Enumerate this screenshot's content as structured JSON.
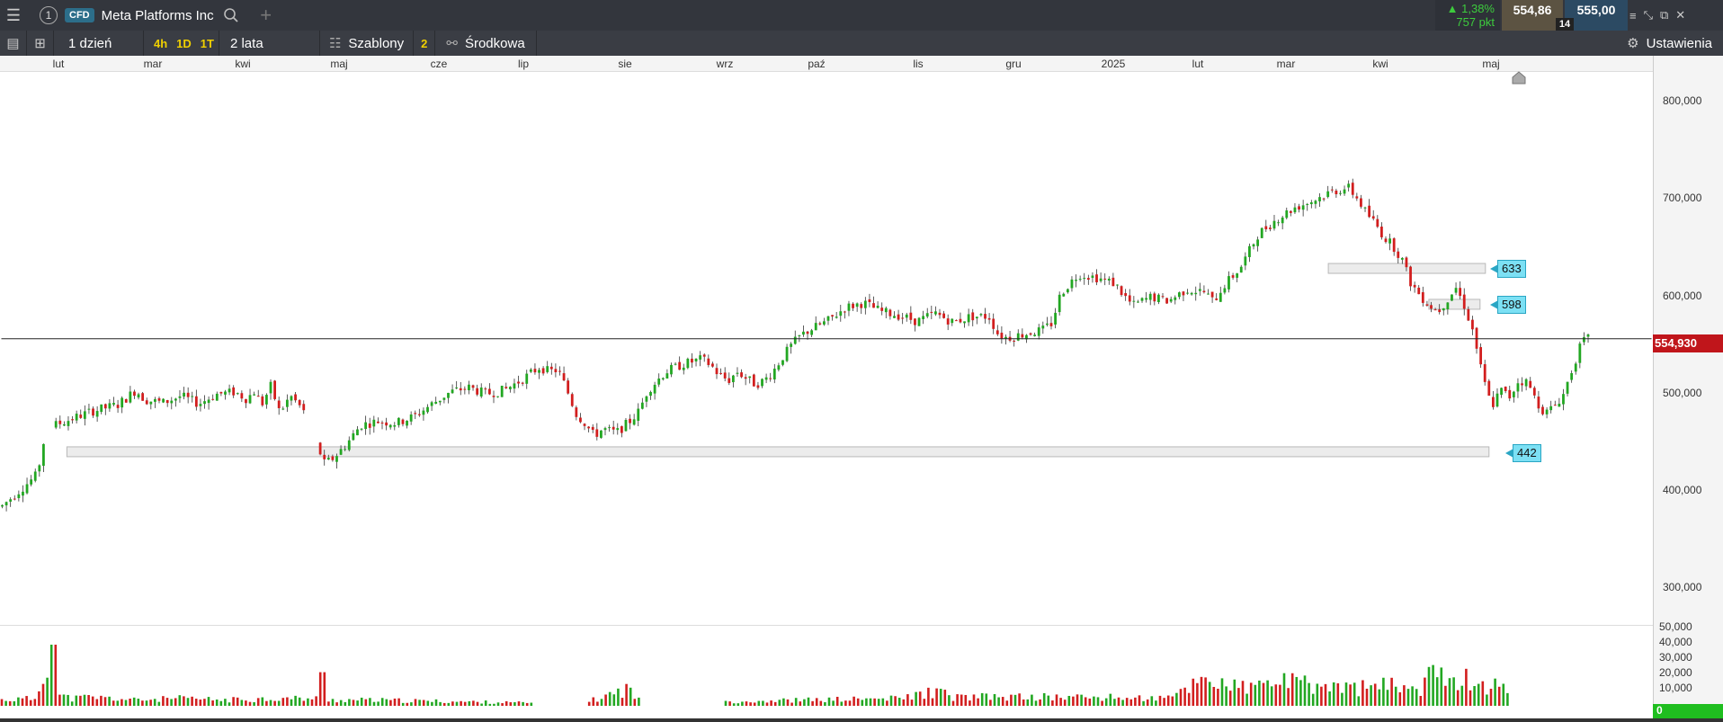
{
  "topbar": {
    "window_number": "1",
    "badge": "CFD",
    "instrument": "Meta Platforms Inc",
    "change_pct": "▲ 1,38%",
    "change_pts": "757 pkt",
    "sell_price": "554,86",
    "spread": "14",
    "buy_price": "555,00"
  },
  "toolbar": {
    "interval": "1 dzień",
    "quick_4h": "4h",
    "quick_1d": "1D",
    "quick_1t": "1T",
    "range": "2 lata",
    "templates": "Szablony",
    "indicator_count": "2",
    "indicator": "Środkowa",
    "settings": "Ustawienia"
  },
  "chart_data": {
    "type": "candlestick",
    "x_labels": [
      "lut",
      "mar",
      "kwi",
      "maj",
      "cze",
      "lip",
      "sie",
      "wrz",
      "paź",
      "lis",
      "gru",
      "2025",
      "lut",
      "mar",
      "kwi",
      "maj"
    ],
    "y_ticks": [
      "800,000",
      "700,000",
      "600,000",
      "500,000",
      "400,000",
      "300,000"
    ],
    "volume_ticks": [
      "50,000",
      "40,000",
      "30,000",
      "20,000",
      "10,000",
      "0"
    ],
    "current_price": "554,930",
    "ylim": [
      260,
      830
    ],
    "levels": [
      {
        "label": "633",
        "value": 627
      },
      {
        "label": "598",
        "value": 590
      },
      {
        "label": "442",
        "value": 438
      }
    ],
    "price_path": [
      [
        0,
        382
      ],
      [
        40,
        415
      ],
      [
        50,
        462
      ],
      [
        60,
        466
      ],
      [
        80,
        473
      ],
      [
        100,
        480
      ],
      [
        130,
        487
      ],
      [
        150,
        502
      ],
      [
        160,
        492
      ],
      [
        180,
        489
      ],
      [
        200,
        496
      ],
      [
        220,
        488
      ],
      [
        240,
        498
      ],
      [
        260,
        500
      ],
      [
        275,
        492
      ],
      [
        280,
        503
      ],
      [
        290,
        487
      ],
      [
        300,
        506
      ],
      [
        310,
        479
      ],
      [
        322,
        496
      ],
      [
        335,
        483
      ],
      [
        360,
        426
      ],
      [
        370,
        432
      ],
      [
        385,
        447
      ],
      [
        400,
        466
      ],
      [
        420,
        470
      ],
      [
        440,
        468
      ],
      [
        460,
        475
      ],
      [
        480,
        488
      ],
      [
        500,
        500
      ],
      [
        520,
        505
      ],
      [
        540,
        498
      ],
      [
        560,
        502
      ],
      [
        580,
        513
      ],
      [
        600,
        526
      ],
      [
        610,
        521
      ],
      [
        620,
        523
      ],
      [
        630,
        502
      ],
      [
        640,
        478
      ],
      [
        650,
        468
      ],
      [
        660,
        455
      ],
      [
        670,
        462
      ],
      [
        685,
        458
      ],
      [
        700,
        470
      ],
      [
        710,
        480
      ],
      [
        720,
        502
      ],
      [
        740,
        521
      ],
      [
        760,
        529
      ],
      [
        780,
        534
      ],
      [
        790,
        528
      ],
      [
        800,
        517
      ],
      [
        810,
        512
      ],
      [
        820,
        521
      ],
      [
        830,
        514
      ],
      [
        840,
        508
      ],
      [
        850,
        512
      ],
      [
        860,
        522
      ],
      [
        870,
        536
      ],
      [
        880,
        548
      ],
      [
        890,
        558
      ],
      [
        900,
        564
      ],
      [
        920,
        573
      ],
      [
        940,
        587
      ],
      [
        960,
        592
      ],
      [
        980,
        583
      ],
      [
        1000,
        579
      ],
      [
        1020,
        573
      ],
      [
        1040,
        581
      ],
      [
        1060,
        572
      ],
      [
        1080,
        578
      ],
      [
        1100,
        578
      ],
      [
        1110,
        560
      ],
      [
        1120,
        556
      ],
      [
        1140,
        560
      ],
      [
        1160,
        564
      ],
      [
        1170,
        571
      ],
      [
        1180,
        602
      ],
      [
        1200,
        622
      ],
      [
        1220,
        618
      ],
      [
        1240,
        612
      ],
      [
        1250,
        600
      ],
      [
        1260,
        589
      ],
      [
        1280,
        598
      ],
      [
        1300,
        594
      ],
      [
        1320,
        606
      ],
      [
        1340,
        603
      ],
      [
        1350,
        593
      ],
      [
        1360,
        608
      ],
      [
        1380,
        628
      ],
      [
        1400,
        663
      ],
      [
        1420,
        678
      ],
      [
        1440,
        690
      ],
      [
        1460,
        697
      ],
      [
        1480,
        706
      ],
      [
        1500,
        711
      ],
      [
        1510,
        700
      ],
      [
        1520,
        685
      ],
      [
        1530,
        674
      ],
      [
        1540,
        660
      ],
      [
        1550,
        651
      ],
      [
        1560,
        637
      ],
      [
        1570,
        612
      ],
      [
        1580,
        600
      ],
      [
        1590,
        590
      ],
      [
        1600,
        583
      ],
      [
        1610,
        595
      ],
      [
        1620,
        608
      ],
      [
        1630,
        588
      ],
      [
        1640,
        560
      ],
      [
        1650,
        515
      ],
      [
        1660,
        485
      ],
      [
        1670,
        502
      ],
      [
        1680,
        495
      ],
      [
        1690,
        512
      ],
      [
        1700,
        510
      ],
      [
        1710,
        490
      ],
      [
        1720,
        478
      ],
      [
        1730,
        486
      ],
      [
        1740,
        498
      ],
      [
        1750,
        525
      ],
      [
        1760,
        550
      ],
      [
        1765,
        555
      ]
    ],
    "volume_path": [
      [
        0,
        4
      ],
      [
        40,
        5
      ],
      [
        55,
        40
      ],
      [
        60,
        8
      ],
      [
        80,
        5
      ],
      [
        100,
        6
      ],
      [
        150,
        4
      ],
      [
        200,
        5
      ],
      [
        250,
        4
      ],
      [
        300,
        5
      ],
      [
        355,
        5
      ],
      [
        360,
        22
      ],
      [
        365,
        4
      ],
      [
        400,
        4
      ],
      [
        500,
        3
      ],
      [
        590,
        2
      ],
      [
        660,
        4
      ],
      [
        700,
        12
      ],
      [
        710,
        4
      ],
      [
        800,
        3
      ],
      [
        900,
        4
      ],
      [
        1000,
        5
      ],
      [
        1040,
        10
      ],
      [
        1060,
        6
      ],
      [
        1100,
        6
      ],
      [
        1200,
        6
      ],
      [
        1300,
        5
      ],
      [
        1340,
        20
      ],
      [
        1360,
        15
      ],
      [
        1380,
        12
      ],
      [
        1400,
        13
      ],
      [
        1420,
        18
      ],
      [
        1440,
        15
      ],
      [
        1460,
        14
      ],
      [
        1500,
        12
      ],
      [
        1560,
        14
      ],
      [
        1580,
        12
      ],
      [
        1600,
        26
      ],
      [
        1610,
        24
      ],
      [
        1620,
        20
      ],
      [
        1640,
        16
      ],
      [
        1660,
        14
      ],
      [
        1680,
        10
      ],
      [
        1700,
        8
      ],
      [
        1710,
        6
      ]
    ]
  }
}
